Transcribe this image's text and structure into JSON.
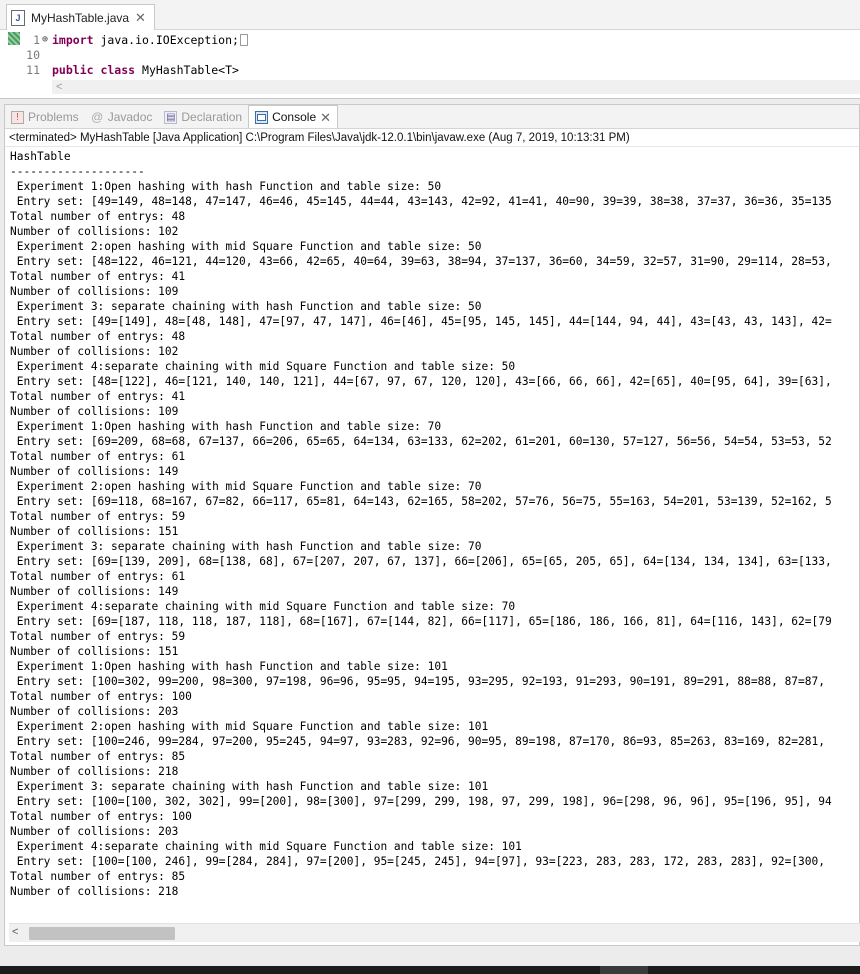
{
  "editor": {
    "tab_label": "MyHashTable.java",
    "tab_icon": "J",
    "lines": [
      {
        "num": "1",
        "fold": "⊕",
        "keyword": "import",
        "rest": " java.io.IOException;"
      },
      {
        "num": "10",
        "fold": "",
        "keyword": "",
        "rest": ""
      },
      {
        "num": "11",
        "fold": "",
        "keyword": "public class",
        "rest": " MyHashTable<T>"
      }
    ],
    "scroll_left": "<"
  },
  "views": {
    "tabs": [
      {
        "label": "Problems",
        "icon": "problems-icon",
        "active": false
      },
      {
        "label": "Javadoc",
        "icon": "javadoc-icon",
        "active": false
      },
      {
        "label": "Declaration",
        "icon": "declaration-icon",
        "active": false
      },
      {
        "label": "Console",
        "icon": "console-icon",
        "active": true
      }
    ],
    "console_header": "<terminated> MyHashTable [Java Application] C:\\Program Files\\Java\\jdk-12.0.1\\bin\\javaw.exe (Aug 7, 2019, 10:13:31 PM)",
    "console_lines": [
      "HashTable",
      "--------------------",
      " Experiment 1:Open hashing with hash Function and table size: 50",
      " Entry set: [49=149, 48=148, 47=147, 46=46, 45=145, 44=44, 43=143, 42=92, 41=41, 40=90, 39=39, 38=38, 37=37, 36=36, 35=135",
      "Total number of entrys: 48",
      "Number of collisions: 102",
      " Experiment 2:open hashing with mid Square Function and table size: 50",
      " Entry set: [48=122, 46=121, 44=120, 43=66, 42=65, 40=64, 39=63, 38=94, 37=137, 36=60, 34=59, 32=57, 31=90, 29=114, 28=53,",
      "Total number of entrys: 41",
      "Number of collisions: 109",
      " Experiment 3: separate chaining with hash Function and table size: 50",
      " Entry set: [49=[149], 48=[48, 148], 47=[97, 47, 147], 46=[46], 45=[95, 145, 145], 44=[144, 94, 44], 43=[43, 43, 143], 42=",
      "Total number of entrys: 48",
      "Number of collisions: 102",
      " Experiment 4:separate chaining with mid Square Function and table size: 50",
      " Entry set: [48=[122], 46=[121, 140, 140, 121], 44=[67, 97, 67, 120, 120], 43=[66, 66, 66], 42=[65], 40=[95, 64], 39=[63],",
      "Total number of entrys: 41",
      "Number of collisions: 109",
      " Experiment 1:Open hashing with hash Function and table size: 70",
      " Entry set: [69=209, 68=68, 67=137, 66=206, 65=65, 64=134, 63=133, 62=202, 61=201, 60=130, 57=127, 56=56, 54=54, 53=53, 52",
      "Total number of entrys: 61",
      "Number of collisions: 149",
      " Experiment 2:open hashing with mid Square Function and table size: 70",
      " Entry set: [69=118, 68=167, 67=82, 66=117, 65=81, 64=143, 62=165, 58=202, 57=76, 56=75, 55=163, 54=201, 53=139, 52=162, 5",
      "Total number of entrys: 59",
      "Number of collisions: 151",
      " Experiment 3: separate chaining with hash Function and table size: 70",
      " Entry set: [69=[139, 209], 68=[138, 68], 67=[207, 207, 67, 137], 66=[206], 65=[65, 205, 65], 64=[134, 134, 134], 63=[133,",
      "Total number of entrys: 61",
      "Number of collisions: 149",
      " Experiment 4:separate chaining with mid Square Function and table size: 70",
      " Entry set: [69=[187, 118, 118, 187, 118], 68=[167], 67=[144, 82], 66=[117], 65=[186, 186, 166, 81], 64=[116, 143], 62=[79",
      "Total number of entrys: 59",
      "Number of collisions: 151",
      " Experiment 1:Open hashing with hash Function and table size: 101",
      " Entry set: [100=302, 99=200, 98=300, 97=198, 96=96, 95=95, 94=195, 93=295, 92=193, 91=293, 90=191, 89=291, 88=88, 87=87,",
      "Total number of entrys: 100",
      "Number of collisions: 203",
      " Experiment 2:open hashing with mid Square Function and table size: 101",
      " Entry set: [100=246, 99=284, 97=200, 95=245, 94=97, 93=283, 92=96, 90=95, 89=198, 87=170, 86=93, 85=263, 83=169, 82=281,",
      "Total number of entrys: 85",
      "Number of collisions: 218",
      " Experiment 3: separate chaining with hash Function and table size: 101",
      " Entry set: [100=[100, 302, 302], 99=[200], 98=[300], 97=[299, 299, 198, 97, 299, 198], 96=[298, 96, 96], 95=[196, 95], 94",
      "Total number of entrys: 100",
      "Number of collisions: 203",
      " Experiment 4:separate chaining with mid Square Function and table size: 101",
      " Entry set: [100=[100, 246], 99=[284, 284], 97=[200], 95=[245, 245], 94=[97], 93=[223, 283, 283, 172, 283, 283], 92=[300,",
      "Total number of entrys: 85",
      "Number of collisions: 218"
    ],
    "scroll_left": "<"
  }
}
